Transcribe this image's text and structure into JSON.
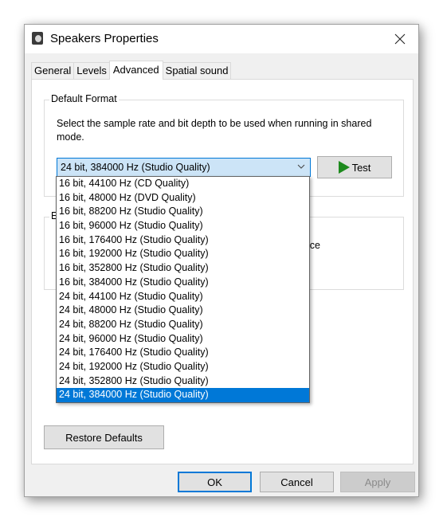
{
  "window": {
    "title": "Speakers Properties",
    "icon": "speaker-icon",
    "close_icon": "close-icon"
  },
  "tabs": [
    {
      "label": "General",
      "active": false
    },
    {
      "label": "Levels",
      "active": false
    },
    {
      "label": "Advanced",
      "active": true
    },
    {
      "label": "Spatial sound",
      "active": false
    }
  ],
  "default_format": {
    "group_label": "Default Format",
    "description": "Select the sample rate and bit depth to be used when running in shared mode.",
    "selected_value": "24 bit, 384000 Hz (Studio Quality)",
    "test_button": "Test",
    "options": [
      "16 bit, 44100 Hz (CD Quality)",
      "16 bit, 48000 Hz (DVD Quality)",
      "16 bit, 88200 Hz (Studio Quality)",
      "16 bit, 96000 Hz (Studio Quality)",
      "16 bit, 176400 Hz (Studio Quality)",
      "16 bit, 192000 Hz (Studio Quality)",
      "16 bit, 352800 Hz (Studio Quality)",
      "16 bit, 384000 Hz (Studio Quality)",
      "24 bit, 44100 Hz (Studio Quality)",
      "24 bit, 48000 Hz (Studio Quality)",
      "24 bit, 88200 Hz (Studio Quality)",
      "24 bit, 96000 Hz (Studio Quality)",
      "24 bit, 176400 Hz (Studio Quality)",
      "24 bit, 192000 Hz (Studio Quality)",
      "24 bit, 352800 Hz (Studio Quality)",
      "24 bit, 384000 Hz (Studio Quality)"
    ],
    "selected_index": 15
  },
  "exclusive_mode": {
    "group_label_partial": "Ex",
    "text_partial": "levice"
  },
  "buttons": {
    "restore_defaults": "Restore Defaults",
    "ok": "OK",
    "cancel": "Cancel",
    "apply": "Apply"
  },
  "colors": {
    "accent": "#0078d7",
    "combo_fill": "#cce4f7",
    "play_green": "#1d8a1d"
  }
}
